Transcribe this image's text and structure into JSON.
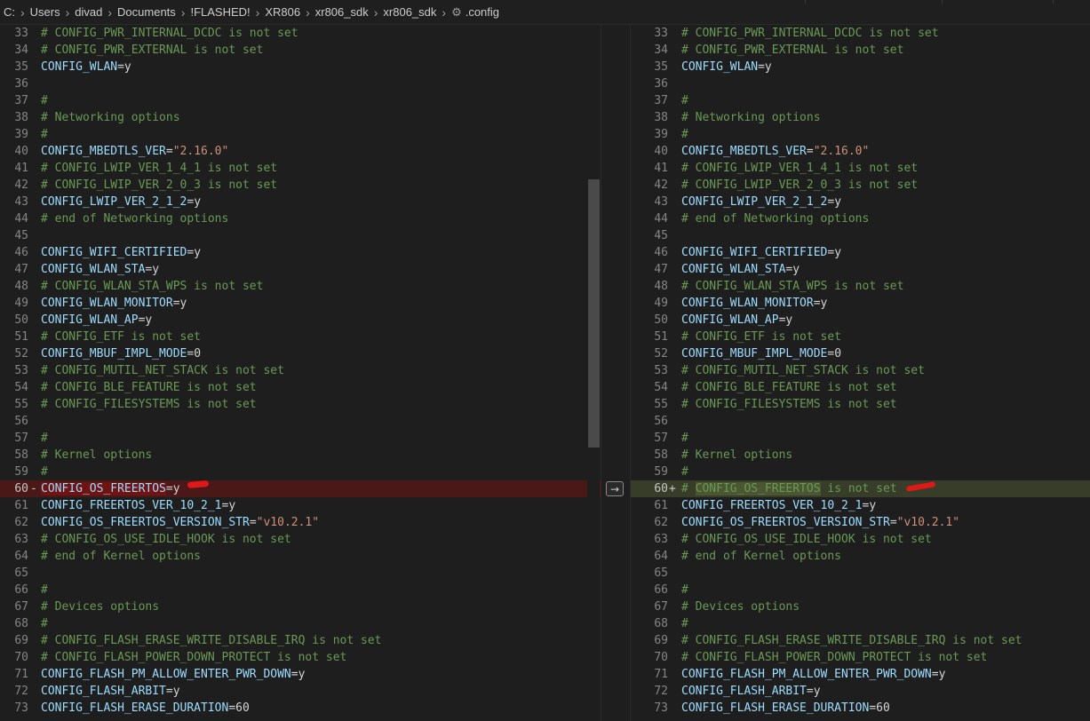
{
  "breadcrumb": {
    "segments": [
      "C:",
      "Users",
      "divad",
      "Documents",
      "!FLASHED!",
      "XR806",
      "xr806_sdk",
      "xr806_sdk"
    ],
    "file": ".config",
    "separator": "›"
  },
  "colors": {
    "comment": "#6a9955",
    "key": "#9cdcfe",
    "plain": "#d4d4d4",
    "string": "#ce9178",
    "removed_bg": "#4b1818",
    "added_bg": "#373d29",
    "red_mark": "#e01818"
  },
  "diff": {
    "revert_icon": "→",
    "removed_marker": "-",
    "added_marker": "+",
    "left_lines": [
      {
        "n": "33",
        "text": "# CONFIG_PWR_INTERNAL_DCDC is not set"
      },
      {
        "n": "34",
        "text": "# CONFIG_PWR_EXTERNAL is not set"
      },
      {
        "n": "35",
        "text": "CONFIG_WLAN=y"
      },
      {
        "n": "36",
        "text": ""
      },
      {
        "n": "37",
        "text": "#"
      },
      {
        "n": "38",
        "text": "# Networking options"
      },
      {
        "n": "39",
        "text": "#"
      },
      {
        "n": "40",
        "text": "CONFIG_MBEDTLS_VER=\"2.16.0\""
      },
      {
        "n": "41",
        "text": "# CONFIG_LWIP_VER_1_4_1 is not set"
      },
      {
        "n": "42",
        "text": "# CONFIG_LWIP_VER_2_0_3 is not set"
      },
      {
        "n": "43",
        "text": "CONFIG_LWIP_VER_2_1_2=y"
      },
      {
        "n": "44",
        "text": "# end of Networking options"
      },
      {
        "n": "45",
        "text": ""
      },
      {
        "n": "46",
        "text": "CONFIG_WIFI_CERTIFIED=y"
      },
      {
        "n": "47",
        "text": "CONFIG_WLAN_STA=y"
      },
      {
        "n": "48",
        "text": "# CONFIG_WLAN_STA_WPS is not set"
      },
      {
        "n": "49",
        "text": "CONFIG_WLAN_MONITOR=y"
      },
      {
        "n": "50",
        "text": "CONFIG_WLAN_AP=y"
      },
      {
        "n": "51",
        "text": "# CONFIG_ETF is not set"
      },
      {
        "n": "52",
        "text": "CONFIG_MBUF_IMPL_MODE=0"
      },
      {
        "n": "53",
        "text": "# CONFIG_MUTIL_NET_STACK is not set"
      },
      {
        "n": "54",
        "text": "# CONFIG_BLE_FEATURE is not set"
      },
      {
        "n": "55",
        "text": "# CONFIG_FILESYSTEMS is not set"
      },
      {
        "n": "56",
        "text": ""
      },
      {
        "n": "57",
        "text": "#"
      },
      {
        "n": "58",
        "text": "# Kernel options"
      },
      {
        "n": "59",
        "text": "#"
      },
      {
        "n": "60",
        "text": "CONFIG_OS_FREERTOS=y",
        "state": "removed"
      },
      {
        "n": "61",
        "text": "CONFIG_FREERTOS_VER_10_2_1=y"
      },
      {
        "n": "62",
        "text": "CONFIG_OS_FREERTOS_VERSION_STR=\"v10.2.1\""
      },
      {
        "n": "63",
        "text": "# CONFIG_OS_USE_IDLE_HOOK is not set"
      },
      {
        "n": "64",
        "text": "# end of Kernel options"
      },
      {
        "n": "65",
        "text": ""
      },
      {
        "n": "66",
        "text": "#"
      },
      {
        "n": "67",
        "text": "# Devices options"
      },
      {
        "n": "68",
        "text": "#"
      },
      {
        "n": "69",
        "text": "# CONFIG_FLASH_ERASE_WRITE_DISABLE_IRQ is not set"
      },
      {
        "n": "70",
        "text": "# CONFIG_FLASH_POWER_DOWN_PROTECT is not set"
      },
      {
        "n": "71",
        "text": "CONFIG_FLASH_PM_ALLOW_ENTER_PWR_DOWN=y"
      },
      {
        "n": "72",
        "text": "CONFIG_FLASH_ARBIT=y"
      },
      {
        "n": "73",
        "text": "CONFIG_FLASH_ERASE_DURATION=60"
      }
    ],
    "right_lines": [
      {
        "n": "33",
        "text": "# CONFIG_PWR_INTERNAL_DCDC is not set"
      },
      {
        "n": "34",
        "text": "# CONFIG_PWR_EXTERNAL is not set"
      },
      {
        "n": "35",
        "text": "CONFIG_WLAN=y"
      },
      {
        "n": "36",
        "text": ""
      },
      {
        "n": "37",
        "text": "#"
      },
      {
        "n": "38",
        "text": "# Networking options"
      },
      {
        "n": "39",
        "text": "#"
      },
      {
        "n": "40",
        "text": "CONFIG_MBEDTLS_VER=\"2.16.0\""
      },
      {
        "n": "41",
        "text": "# CONFIG_LWIP_VER_1_4_1 is not set"
      },
      {
        "n": "42",
        "text": "# CONFIG_LWIP_VER_2_0_3 is not set"
      },
      {
        "n": "43",
        "text": "CONFIG_LWIP_VER_2_1_2=y"
      },
      {
        "n": "44",
        "text": "# end of Networking options"
      },
      {
        "n": "45",
        "text": ""
      },
      {
        "n": "46",
        "text": "CONFIG_WIFI_CERTIFIED=y"
      },
      {
        "n": "47",
        "text": "CONFIG_WLAN_STA=y"
      },
      {
        "n": "48",
        "text": "# CONFIG_WLAN_STA_WPS is not set"
      },
      {
        "n": "49",
        "text": "CONFIG_WLAN_MONITOR=y"
      },
      {
        "n": "50",
        "text": "CONFIG_WLAN_AP=y"
      },
      {
        "n": "51",
        "text": "# CONFIG_ETF is not set"
      },
      {
        "n": "52",
        "text": "CONFIG_MBUF_IMPL_MODE=0"
      },
      {
        "n": "53",
        "text": "# CONFIG_MUTIL_NET_STACK is not set"
      },
      {
        "n": "54",
        "text": "# CONFIG_BLE_FEATURE is not set"
      },
      {
        "n": "55",
        "text": "# CONFIG_FILESYSTEMS is not set"
      },
      {
        "n": "56",
        "text": ""
      },
      {
        "n": "57",
        "text": "#"
      },
      {
        "n": "58",
        "text": "# Kernel options"
      },
      {
        "n": "59",
        "text": "#"
      },
      {
        "n": "60",
        "text": "# CONFIG_OS_FREERTOS is not set",
        "state": "added"
      },
      {
        "n": "61",
        "text": "CONFIG_FREERTOS_VER_10_2_1=y"
      },
      {
        "n": "62",
        "text": "CONFIG_OS_FREERTOS_VERSION_STR=\"v10.2.1\""
      },
      {
        "n": "63",
        "text": "# CONFIG_OS_USE_IDLE_HOOK is not set"
      },
      {
        "n": "64",
        "text": "# end of Kernel options"
      },
      {
        "n": "65",
        "text": ""
      },
      {
        "n": "66",
        "text": "#"
      },
      {
        "n": "67",
        "text": "# Devices options"
      },
      {
        "n": "68",
        "text": "#"
      },
      {
        "n": "69",
        "text": "# CONFIG_FLASH_ERASE_WRITE_DISABLE_IRQ is not set"
      },
      {
        "n": "70",
        "text": "# CONFIG_FLASH_POWER_DOWN_PROTECT is not set"
      },
      {
        "n": "71",
        "text": "CONFIG_FLASH_PM_ALLOW_ENTER_PWR_DOWN=y"
      },
      {
        "n": "72",
        "text": "CONFIG_FLASH_ARBIT=y"
      },
      {
        "n": "73",
        "text": "CONFIG_FLASH_ERASE_DURATION=60"
      }
    ]
  }
}
